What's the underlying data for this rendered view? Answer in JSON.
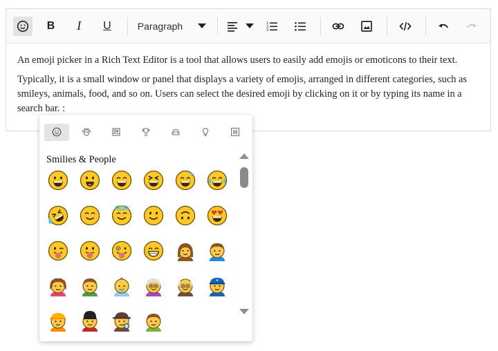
{
  "toolbar": {
    "bold_label": "B",
    "italic_label": "I",
    "underline_label": "U",
    "format_value": "Paragraph"
  },
  "content": {
    "paragraph1": "An emoji picker in a Rich Text Editor is a tool that allows users to easily add emojis or emoticons to their text.",
    "paragraph2": "Typically, it is a small window or panel that displays a variety of emojis, arranged in different categories, such as smileys, animals, food, and so on. Users can select the desired emoji by clicking on it or by typing its name in a search bar. :"
  },
  "emoji_picker": {
    "categories": [
      "smileys-people-icon",
      "animals-nature-icon",
      "food-drink-icon",
      "activities-icon",
      "travel-places-icon",
      "objects-icon",
      "symbols-icon"
    ],
    "active_category": 0,
    "section_title": "Smilies & People",
    "emojis": [
      "grinning-face",
      "smiling-face-open-mouth",
      "grinning-face-smiling-eyes",
      "grinning-squinting-face",
      "grinning-face-sweat",
      "face-tears-of-joy",
      "rolling-on-floor-laughing",
      "smiling-face-smiling-eyes",
      "smiling-face-halo",
      "slightly-smiling-face",
      "upside-down-face",
      "heart-eyes",
      "winking-face-tongue",
      "face-with-tongue",
      "zany-face",
      "beaming-face",
      "woman",
      "man",
      "girl",
      "boy",
      "baby",
      "old-woman",
      "old-man",
      "police-officer",
      "construction-worker",
      "guard",
      "detective",
      "child"
    ]
  },
  "colors": {
    "emoji_yellow": "#FFCA28",
    "emoji_outline": "#6D4C00",
    "toolbar_bg": "#FAFAFA",
    "active_bg": "#E2E2E2"
  }
}
